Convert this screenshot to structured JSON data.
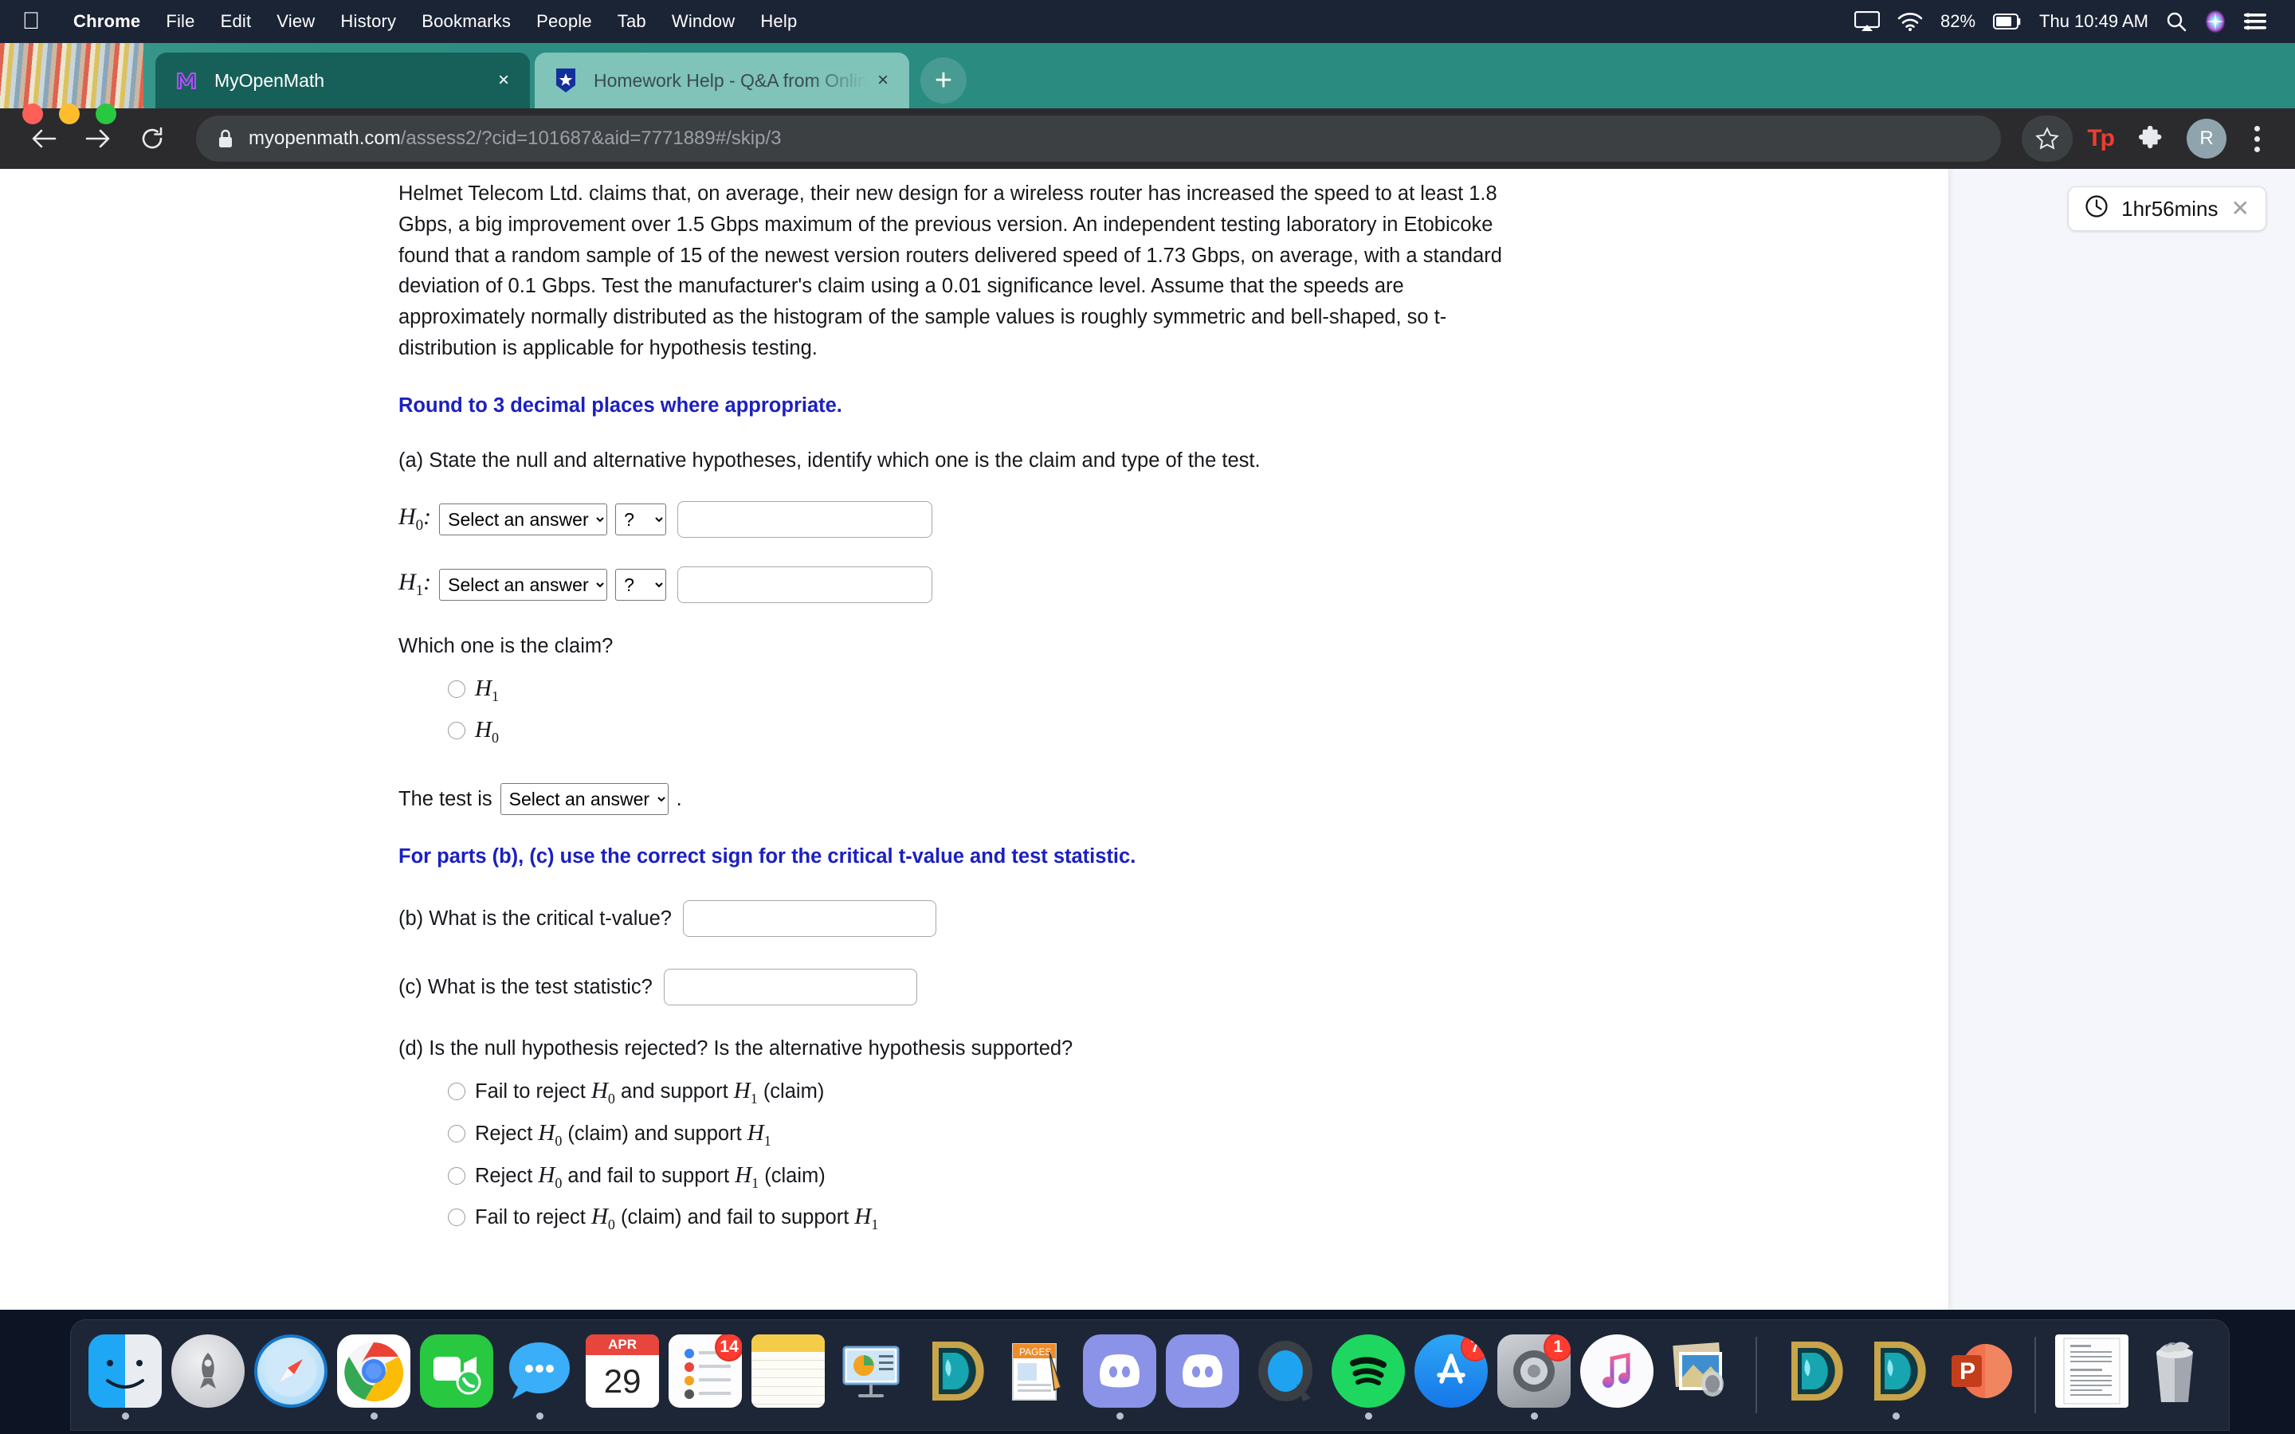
{
  "menubar": {
    "apple": "",
    "items": [
      {
        "label": "Chrome",
        "bold": true
      },
      {
        "label": "File",
        "bold": false
      },
      {
        "label": "Edit",
        "bold": false
      },
      {
        "label": "View",
        "bold": false
      },
      {
        "label": "History",
        "bold": false
      },
      {
        "label": "Bookmarks",
        "bold": false
      },
      {
        "label": "People",
        "bold": false
      },
      {
        "label": "Tab",
        "bold": false
      },
      {
        "label": "Window",
        "bold": false
      },
      {
        "label": "Help",
        "bold": false
      }
    ],
    "battery_percent": "82%",
    "clock": "Thu 10:49 AM"
  },
  "browser": {
    "tabs": [
      {
        "title": "MyOpenMath",
        "active": true,
        "close_label": "×"
      },
      {
        "title": "Homework Help - Q&A from Online Tutors",
        "active": false,
        "close_label": "×"
      }
    ],
    "new_tab_label": "+",
    "url_domain": "myopenmath.com",
    "url_path": "/assess2/?cid=101687&aid=7771889#/skip/3",
    "extension_label": "Tp",
    "profile_initial": "R"
  },
  "timer": {
    "time_remaining": "1hr56mins",
    "close_label": "✕"
  },
  "question": {
    "body": "Helmet Telecom Ltd. claims that, on average, their new design for a wireless router has increased the speed to at least 1.8 Gbps, a big improvement over 1.5 Gbps maximum of the previous version. An independent testing laboratory in Etobicoke found that a random sample of 15 of the newest version routers delivered speed of 1.73 Gbps, on average, with a standard deviation of 0.1 Gbps. Test the manufacturer's claim using a 0.01 significance level. Assume that the speeds are approximately normally distributed as the histogram of the sample values is roughly symmetric and bell-shaped, so t-distribution is applicable for hypothesis testing.",
    "rounding_note": "Round to 3 decimal places where appropriate.",
    "part_a": "(a) State the null and alternative hypotheses, identify which one is the claim and type of the test.",
    "h0_label": "H",
    "h0_sub": "0",
    "h0_colon": ":",
    "h1_label": "H",
    "h1_sub": "1",
    "h1_colon": ":",
    "select_placeholder": "Select an answer",
    "operator_placeholder": "?",
    "h0_value": "",
    "h0_operator": "?",
    "h0_text_value": "",
    "h1_value": "",
    "h1_operator": "?",
    "h1_text_value": "",
    "claim_question": "Which one is the claim?",
    "claim_options": [
      {
        "prefix": "",
        "var": "H",
        "sub": "1",
        "suffix": ""
      },
      {
        "prefix": "",
        "var": "H",
        "sub": "0",
        "suffix": ""
      }
    ],
    "test_is_prefix": "The test is",
    "test_is_value": "Select an answer",
    "test_is_suffix": ".",
    "sign_note": "For parts (b), (c) use the correct sign for the critical t-value and test statistic.",
    "part_b": "(b) What is the critical t-value?",
    "part_b_value": "",
    "part_c": "(c) What is the test statistic?",
    "part_c_value": "",
    "part_d": "(d) Is the null hypothesis rejected? Is the alternative hypothesis supported?",
    "part_d_options": [
      {
        "t1": "Fail to reject ",
        "v1": "H",
        "s1": "0",
        "t2": " and support ",
        "v2": "H",
        "s2": "1",
        "t3": " (claim)"
      },
      {
        "t1": "Reject ",
        "v1": "H",
        "s1": "0",
        "t2": " (claim) and support ",
        "v2": "H",
        "s2": "1",
        "t3": ""
      },
      {
        "t1": "Reject ",
        "v1": "H",
        "s1": "0",
        "t2": " and fail to support ",
        "v2": "H",
        "s2": "1",
        "t3": " (claim)"
      },
      {
        "t1": "Fail to reject ",
        "v1": "H",
        "s1": "0",
        "t2": " (claim) and fail to support ",
        "v2": "H",
        "s2": "1",
        "t3": ""
      }
    ]
  },
  "dock": {
    "items": [
      {
        "name": "finder",
        "running": true,
        "badge": ""
      },
      {
        "name": "launchpad",
        "running": false,
        "badge": ""
      },
      {
        "name": "safari",
        "running": false,
        "badge": ""
      },
      {
        "name": "chrome",
        "running": true,
        "badge": ""
      },
      {
        "name": "facetime",
        "running": false,
        "badge": ""
      },
      {
        "name": "messages",
        "running": true,
        "badge": ""
      },
      {
        "name": "calendar",
        "running": false,
        "badge": "",
        "month": "APR",
        "day": "29"
      },
      {
        "name": "reminders",
        "running": false,
        "badge": "14"
      },
      {
        "name": "notes",
        "running": false,
        "badge": ""
      },
      {
        "name": "keynote",
        "running": false,
        "badge": ""
      },
      {
        "name": "league-of-legends",
        "running": false,
        "badge": ""
      },
      {
        "name": "pages",
        "running": false,
        "badge": ""
      },
      {
        "name": "discord",
        "running": true,
        "badge": ""
      },
      {
        "name": "discord-canary",
        "running": false,
        "badge": ""
      },
      {
        "name": "quicktime",
        "running": false,
        "badge": ""
      },
      {
        "name": "spotify",
        "running": true,
        "badge": ""
      },
      {
        "name": "app-store",
        "running": false,
        "badge": "7"
      },
      {
        "name": "system-preferences",
        "running": true,
        "badge": "1"
      },
      {
        "name": "itunes",
        "running": false,
        "badge": ""
      },
      {
        "name": "preview",
        "running": false,
        "badge": ""
      },
      {
        "name": "lol-client-1",
        "running": false,
        "badge": ""
      },
      {
        "name": "lol-client-2",
        "running": true,
        "badge": ""
      },
      {
        "name": "powerpoint",
        "running": false,
        "badge": "",
        "letter": "P"
      },
      {
        "name": "document-file",
        "running": false,
        "badge": ""
      },
      {
        "name": "trash",
        "running": false,
        "badge": ""
      }
    ]
  }
}
